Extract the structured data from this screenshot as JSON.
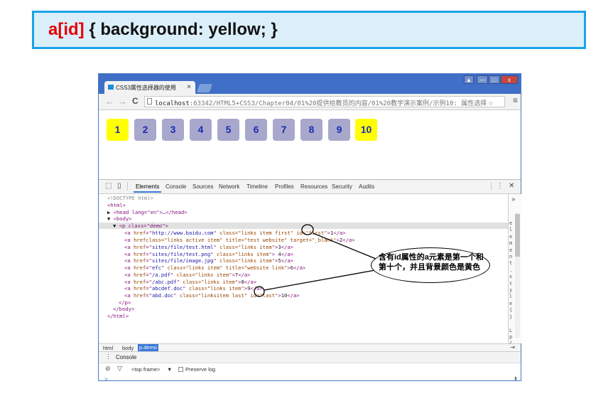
{
  "banner": {
    "selector": "a[id]",
    "rule": " { background: yellow; }"
  },
  "browser": {
    "tab_title": "CSS3属性选择器的使用",
    "tab_close": "×",
    "window_controls": [
      "▲",
      "—",
      "□",
      "x"
    ],
    "nav": {
      "back": "←",
      "forward": "→",
      "reload": "C"
    },
    "url_host": "localhost",
    "url_path": ":63342/HTML5+CSS3/Chapter04/01%20提供给教员的内容/01%20教学演示案例/示例10: 属性选择",
    "star": "☆",
    "menu": "≡"
  },
  "page": {
    "links": [
      {
        "label": "1",
        "highlighted": true
      },
      {
        "label": "2",
        "highlighted": false
      },
      {
        "label": "3",
        "highlighted": false
      },
      {
        "label": "4",
        "highlighted": false
      },
      {
        "label": "5",
        "highlighted": false
      },
      {
        "label": "6",
        "highlighted": false
      },
      {
        "label": "7",
        "highlighted": false
      },
      {
        "label": "8",
        "highlighted": false
      },
      {
        "label": "9",
        "highlighted": false
      },
      {
        "label": "10",
        "highlighted": true
      }
    ],
    "colors": {
      "highlight": "#ffff00",
      "normal": "#a8a8cc",
      "text": "#1c2db3"
    }
  },
  "devtools": {
    "tabs": [
      "Elements",
      "Console",
      "Sources",
      "Network",
      "Timeline",
      "Profiles",
      "Resources",
      "Security",
      "Audits"
    ],
    "active_tab": "Elements",
    "menu_icon": "⋮",
    "close_icon": "✕",
    "side_chevron": "»",
    "side_letters": "e\nl\ne\nm\ne\nn\nt\n.\ns\nt\ny\nl\ne\n{\n}\n\nL\np\n{",
    "code": {
      "doctype": "<!DOCTYPE html>",
      "html_open": "<html>",
      "head": "<head lang=\"en\">…</head>",
      "body_open": "<body>",
      "p_open": "<p class=\"demo\">",
      "anchors": [
        {
          "href": "http://www.baidu.com",
          "extra": " class=\"links item first\" id=\"first\"",
          "text": "1"
        },
        {
          "href": "",
          "extra": "class=\"links active item\" title=\"test website\" target=\"_blank\"",
          "text": "2"
        },
        {
          "href": "sites/file/test.html",
          "extra": " class=\"links item\"",
          "text": "3"
        },
        {
          "href": "sites/file/test.png",
          "extra": " class=\"links item\"",
          "text": " 4"
        },
        {
          "href": "sites/file/image.jpg",
          "extra": " class=\"links item\"",
          "text": "5"
        },
        {
          "href": "efc",
          "extra": " class=\"links item\" title=\"website link\"",
          "text": "6"
        },
        {
          "href": "/a.pdf",
          "extra": " class=\"links item\"",
          "text": "7"
        },
        {
          "href": "/abc.pdf",
          "extra": " class=\"links item\"",
          "text": "8"
        },
        {
          "href": "abcdef.doc",
          "extra": " class=\"links item\"",
          "text": "9"
        },
        {
          "href": "abd.doc",
          "extra": " class=\"linksitem last\" id=\"last\"",
          "text": "10"
        }
      ],
      "p_close": "</p>",
      "body_close": "</body>",
      "html_close": "</html>"
    },
    "breadcrumbs": [
      "html",
      "body",
      "p.demo"
    ],
    "drawer_tab": "Console",
    "console_filter": "<top frame>",
    "console_filter_arrow": "▼",
    "preserve_log": "Preserve log",
    "prompt": ">"
  },
  "annotation": {
    "text_line1": "含有id属性的a元素是第一个和",
    "text_line2": "第十个，并且背景颜色是黄色"
  }
}
